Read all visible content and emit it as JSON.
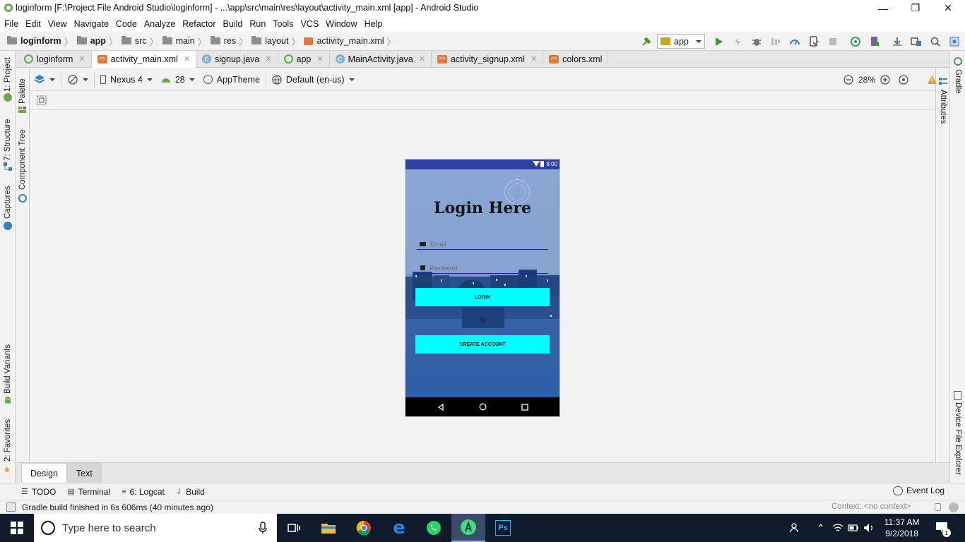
{
  "window": {
    "title": "loginform [F:\\Project File Android Studio\\loginform] - ...\\app\\src\\main\\res\\layout\\activity_main.xml [app] - Android Studio",
    "minimize": "—",
    "maximize": "❐",
    "close": "✕"
  },
  "menu": [
    "File",
    "Edit",
    "View",
    "Navigate",
    "Code",
    "Analyze",
    "Refactor",
    "Build",
    "Run",
    "Tools",
    "VCS",
    "Window",
    "Help"
  ],
  "breadcrumb": [
    "loginform",
    "app",
    "src",
    "main",
    "res",
    "layout",
    "activity_main.xml"
  ],
  "run_config": "app",
  "tabs": [
    {
      "label": "loginform",
      "icon": "android-module-icon"
    },
    {
      "label": "activity_main.xml",
      "icon": "xml-file-icon",
      "active": true
    },
    {
      "label": "signup.java",
      "icon": "class-icon"
    },
    {
      "label": "app",
      "icon": "android-module-icon"
    },
    {
      "label": "MainActivity.java",
      "icon": "class-icon"
    },
    {
      "label": "activity_signup.xml",
      "icon": "xml-file-icon"
    },
    {
      "label": "colors.xml",
      "icon": "xml-file-icon"
    }
  ],
  "left_tools": [
    "1: Project",
    "7: Structure",
    "Captures",
    "Build Variants",
    "2: Favorites"
  ],
  "left_tools2": [
    "Palette",
    "Component Tree"
  ],
  "right_tools": [
    "Gradle",
    "Device File Explorer"
  ],
  "right_tools2": [
    "Attributes"
  ],
  "design_toolbar": {
    "device": "Nexus 4",
    "api": "28",
    "theme": "AppTheme",
    "locale": "Default (en-us)",
    "zoom": "28%"
  },
  "phone": {
    "clock": "8:00",
    "title": "Login Here",
    "email_placeholder": "Email",
    "password_placeholder": "Password",
    "login_label": "LOGIN",
    "or_label": "Or",
    "create_label": "CREATE ACCOUNT"
  },
  "editor_tabs": {
    "design": "Design",
    "text": "Text"
  },
  "tool_windows": [
    "TODO",
    "Terminal",
    "6: Logcat",
    "Build"
  ],
  "event_log": "Event Log",
  "status": {
    "message": "Gradle build finished in 6s 606ms (40 minutes ago)",
    "context": "Context: <no context>"
  },
  "taskbar": {
    "search_placeholder": "Type here to search",
    "time": "11:37 AM",
    "date": "9/2/2018",
    "notifications": "1"
  },
  "colors": {
    "accent_cyan": "#00ffff",
    "status_bar": "#303f9f",
    "phone_bg": "#2b5fa8"
  }
}
